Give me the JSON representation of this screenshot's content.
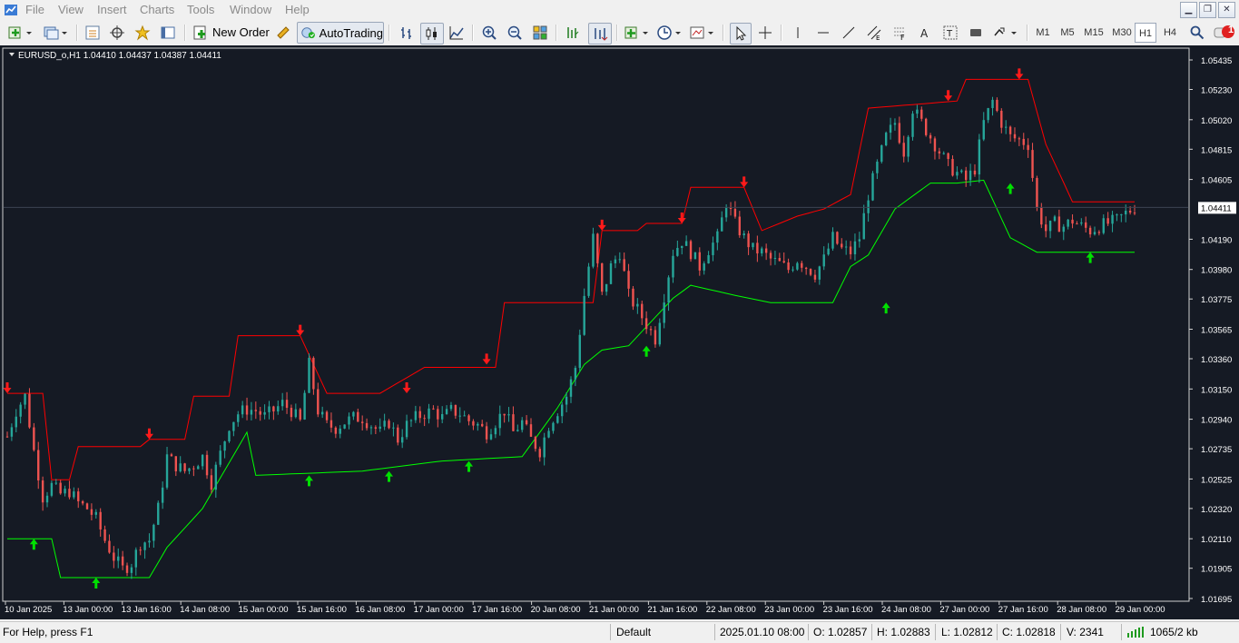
{
  "menu": [
    "File",
    "View",
    "Insert",
    "Charts",
    "Tools",
    "Window",
    "Help"
  ],
  "toolbar": {
    "new_order_label": "New Order",
    "autotrading_label": "AutoTrading",
    "timeframes": [
      "M1",
      "M5",
      "M15",
      "M30",
      "H1",
      "H4"
    ],
    "active_timeframe": "H1",
    "notification_count": "1"
  },
  "chart": {
    "header": "EURUSD_o,H1  1.04410 1.04437 1.04387 1.04411",
    "current_price_label": "1.04411",
    "current_price": 1.04411,
    "colors": {
      "background": "#151a24",
      "bull": "#26a69a",
      "bear": "#ef5350",
      "upper_band": "#ff0000",
      "lower_band": "#00ff00",
      "sell_arrow": "#ff1a1a",
      "buy_arrow": "#00e000"
    }
  },
  "chart_data": {
    "type": "candlestick",
    "symbol": "EURUSD_o",
    "timeframe": "H1",
    "ohlc_last": {
      "open": 1.0441,
      "high": 1.04437,
      "low": 1.04387,
      "close": 1.04411
    },
    "price_axis_ticks": [
      "1.05435",
      "1.05230",
      "1.05020",
      "1.04815",
      "1.04605",
      "1.04190",
      "1.03980",
      "1.03775",
      "1.03565",
      "1.03360",
      "1.03150",
      "1.02940",
      "1.02735",
      "1.02525",
      "1.02320",
      "1.02110",
      "1.01905",
      "1.01695"
    ],
    "time_axis_ticks": [
      "10 Jan 2025",
      "13 Jan 00:00",
      "13 Jan 16:00",
      "14 Jan 08:00",
      "15 Jan 00:00",
      "15 Jan 16:00",
      "16 Jan 08:00",
      "17 Jan 00:00",
      "17 Jan 16:00",
      "20 Jan 08:00",
      "21 Jan 00:00",
      "21 Jan 16:00",
      "22 Jan 08:00",
      "23 Jan 00:00",
      "23 Jan 16:00",
      "24 Jan 08:00",
      "27 Jan 00:00",
      "27 Jan 16:00",
      "28 Jan 08:00",
      "29 Jan 00:00"
    ],
    "ylim": [
      1.01695,
      1.05435
    ],
    "price_trajectory": [
      [
        0,
        1.0282
      ],
      [
        1,
        1.03
      ],
      [
        2,
        1.031
      ],
      [
        3,
        1.0272
      ],
      [
        4,
        1.024
      ],
      [
        5,
        1.0248
      ],
      [
        6,
        1.0242
      ],
      [
        7,
        1.0244
      ],
      [
        8,
        1.0236
      ],
      [
        9,
        1.0232
      ],
      [
        10,
        1.0225
      ],
      [
        11,
        1.021
      ],
      [
        12,
        1.0198
      ],
      [
        13,
        1.019
      ],
      [
        14,
        1.0194
      ],
      [
        15,
        1.0208
      ],
      [
        16,
        1.021
      ],
      [
        17,
        1.0232
      ],
      [
        18,
        1.0268
      ],
      [
        19,
        1.0262
      ],
      [
        20,
        1.0258
      ],
      [
        21,
        1.0262
      ],
      [
        22,
        1.0268
      ],
      [
        23,
        1.025
      ],
      [
        24,
        1.027
      ],
      [
        25,
        1.029
      ],
      [
        26,
        1.0298
      ],
      [
        27,
        1.0301
      ],
      [
        28,
        1.03
      ],
      [
        29,
        1.0296
      ],
      [
        30,
        1.03
      ],
      [
        31,
        1.0305
      ],
      [
        32,
        1.03
      ],
      [
        33,
        1.0292
      ],
      [
        34,
        1.0332
      ],
      [
        35,
        1.03
      ],
      [
        36,
        1.029
      ],
      [
        37,
        1.0288
      ],
      [
        38,
        1.0292
      ],
      [
        39,
        1.0295
      ],
      [
        40,
        1.0295
      ],
      [
        41,
        1.029
      ],
      [
        42,
        1.0285
      ],
      [
        43,
        1.0292
      ],
      [
        44,
        1.028
      ],
      [
        45,
        1.029
      ],
      [
        46,
        1.0295
      ],
      [
        47,
        1.0298
      ],
      [
        48,
        1.03
      ],
      [
        49,
        1.0295
      ],
      [
        50,
        1.03
      ],
      [
        51,
        1.0298
      ],
      [
        52,
        1.0293
      ],
      [
        53,
        1.029
      ],
      [
        54,
        1.0285
      ],
      [
        55,
        1.0292
      ],
      [
        56,
        1.03
      ],
      [
        57,
        1.0285
      ],
      [
        58,
        1.0292
      ],
      [
        59,
        1.028
      ],
      [
        60,
        1.0272
      ],
      [
        61,
        1.029
      ],
      [
        62,
        1.03
      ],
      [
        63,
        1.031
      ],
      [
        64,
        1.033
      ],
      [
        65,
        1.038
      ],
      [
        66,
        1.042
      ],
      [
        67,
        1.038
      ],
      [
        68,
        1.04
      ],
      [
        69,
        1.041
      ],
      [
        70,
        1.038
      ],
      [
        71,
        1.037
      ],
      [
        72,
        1.036
      ],
      [
        73,
        1.035
      ],
      [
        74,
        1.038
      ],
      [
        75,
        1.041
      ],
      [
        76,
        1.0418
      ],
      [
        77,
        1.041
      ],
      [
        78,
        1.04
      ],
      [
        79,
        1.0412
      ],
      [
        80,
        1.042
      ],
      [
        81,
        1.0445
      ],
      [
        82,
        1.043
      ],
      [
        83,
        1.042
      ],
      [
        84,
        1.0412
      ],
      [
        85,
        1.041
      ],
      [
        86,
        1.0405
      ],
      [
        87,
        1.0402
      ],
      [
        88,
        1.0398
      ],
      [
        89,
        1.0405
      ],
      [
        90,
        1.04
      ],
      [
        91,
        1.0395
      ],
      [
        92,
        1.0405
      ],
      [
        93,
        1.042
      ],
      [
        94,
        1.0412
      ],
      [
        95,
        1.041
      ],
      [
        96,
        1.042
      ],
      [
        97,
        1.045
      ],
      [
        98,
        1.047
      ],
      [
        99,
        1.049
      ],
      [
        100,
        1.05
      ],
      [
        101,
        1.048
      ],
      [
        102,
        1.051
      ],
      [
        103,
        1.05
      ],
      [
        104,
        1.049
      ],
      [
        105,
        1.048
      ],
      [
        106,
        1.047
      ],
      [
        107,
        1.0465
      ],
      [
        108,
        1.046
      ],
      [
        109,
        1.0468
      ],
      [
        110,
        1.05
      ],
      [
        111,
        1.0515
      ],
      [
        112,
        1.05
      ],
      [
        113,
        1.049
      ],
      [
        114,
        1.0488
      ],
      [
        115,
        1.0485
      ],
      [
        116,
        1.044
      ],
      [
        117,
        1.0425
      ],
      [
        118,
        1.043
      ],
      [
        119,
        1.0428
      ],
      [
        120,
        1.0432
      ],
      [
        121,
        1.0428
      ],
      [
        122,
        1.0425
      ],
      [
        123,
        1.0428
      ],
      [
        124,
        1.043
      ],
      [
        125,
        1.0432
      ],
      [
        126,
        1.0437
      ],
      [
        127,
        1.0441
      ]
    ],
    "upper_band_trajectory": [
      [
        0,
        1.0312
      ],
      [
        4,
        1.0312
      ],
      [
        5,
        1.0252
      ],
      [
        7,
        1.0252
      ],
      [
        8,
        1.0275
      ],
      [
        15,
        1.0275
      ],
      [
        16,
        1.028
      ],
      [
        20,
        1.028
      ],
      [
        21,
        1.031
      ],
      [
        25,
        1.031
      ],
      [
        26,
        1.0352
      ],
      [
        33,
        1.0352
      ],
      [
        36,
        1.0312
      ],
      [
        42,
        1.0312
      ],
      [
        47,
        1.033
      ],
      [
        55,
        1.033
      ],
      [
        56,
        1.0375
      ],
      [
        66,
        1.0375
      ],
      [
        67,
        1.0425
      ],
      [
        71,
        1.0425
      ],
      [
        72,
        1.043
      ],
      [
        76,
        1.043
      ],
      [
        77,
        1.0455
      ],
      [
        83,
        1.0455
      ],
      [
        85,
        1.0425
      ],
      [
        89,
        1.0435
      ],
      [
        92,
        1.044
      ],
      [
        95,
        1.045
      ],
      [
        97,
        1.051
      ],
      [
        107,
        1.0515
      ],
      [
        108,
        1.053
      ],
      [
        115,
        1.053
      ],
      [
        117,
        1.0485
      ],
      [
        120,
        1.0445
      ],
      [
        127,
        1.0445
      ]
    ],
    "lower_band_trajectory": [
      [
        0,
        1.0211
      ],
      [
        5,
        1.0211
      ],
      [
        6,
        1.0184
      ],
      [
        16,
        1.0184
      ],
      [
        18,
        1.0205
      ],
      [
        22,
        1.0232
      ],
      [
        27,
        1.0285
      ],
      [
        28,
        1.0255
      ],
      [
        40,
        1.0258
      ],
      [
        49,
        1.0265
      ],
      [
        58,
        1.0268
      ],
      [
        62,
        1.0302
      ],
      [
        65,
        1.0332
      ],
      [
        67,
        1.0342
      ],
      [
        70,
        1.0345
      ],
      [
        75,
        1.0378
      ],
      [
        77,
        1.0387
      ],
      [
        82,
        1.038
      ],
      [
        86,
        1.0375
      ],
      [
        90,
        1.0375
      ],
      [
        93,
        1.0375
      ],
      [
        95,
        1.04
      ],
      [
        97,
        1.0408
      ],
      [
        100,
        1.044
      ],
      [
        104,
        1.0458
      ],
      [
        107,
        1.0458
      ],
      [
        110,
        1.046
      ],
      [
        113,
        1.042
      ],
      [
        116,
        1.041
      ],
      [
        127,
        1.041
      ]
    ],
    "sell_signals": [
      [
        0,
        1.0312
      ],
      [
        16,
        1.028
      ],
      [
        33,
        1.0352
      ],
      [
        45,
        1.0312
      ],
      [
        54,
        1.0332
      ],
      [
        67,
        1.0425
      ],
      [
        76,
        1.043
      ],
      [
        83,
        1.0455
      ],
      [
        106,
        1.0515
      ],
      [
        114,
        1.053
      ]
    ],
    "buy_signals": [
      [
        3,
        1.0211
      ],
      [
        10,
        1.0184
      ],
      [
        34,
        1.0255
      ],
      [
        43,
        1.0258
      ],
      [
        52,
        1.0265
      ],
      [
        72,
        1.0345
      ],
      [
        99,
        1.0375
      ],
      [
        113,
        1.0458
      ],
      [
        122,
        1.041
      ]
    ]
  },
  "status": {
    "help": "For Help, press F1",
    "profile": "Default",
    "datetime": "2025.01.10 08:00",
    "open": "O: 1.02857",
    "high": "H: 1.02883",
    "low": "L: 1.02812",
    "close": "C: 1.02818",
    "volume": "V: 2341",
    "traffic": "1065/2 kb"
  }
}
